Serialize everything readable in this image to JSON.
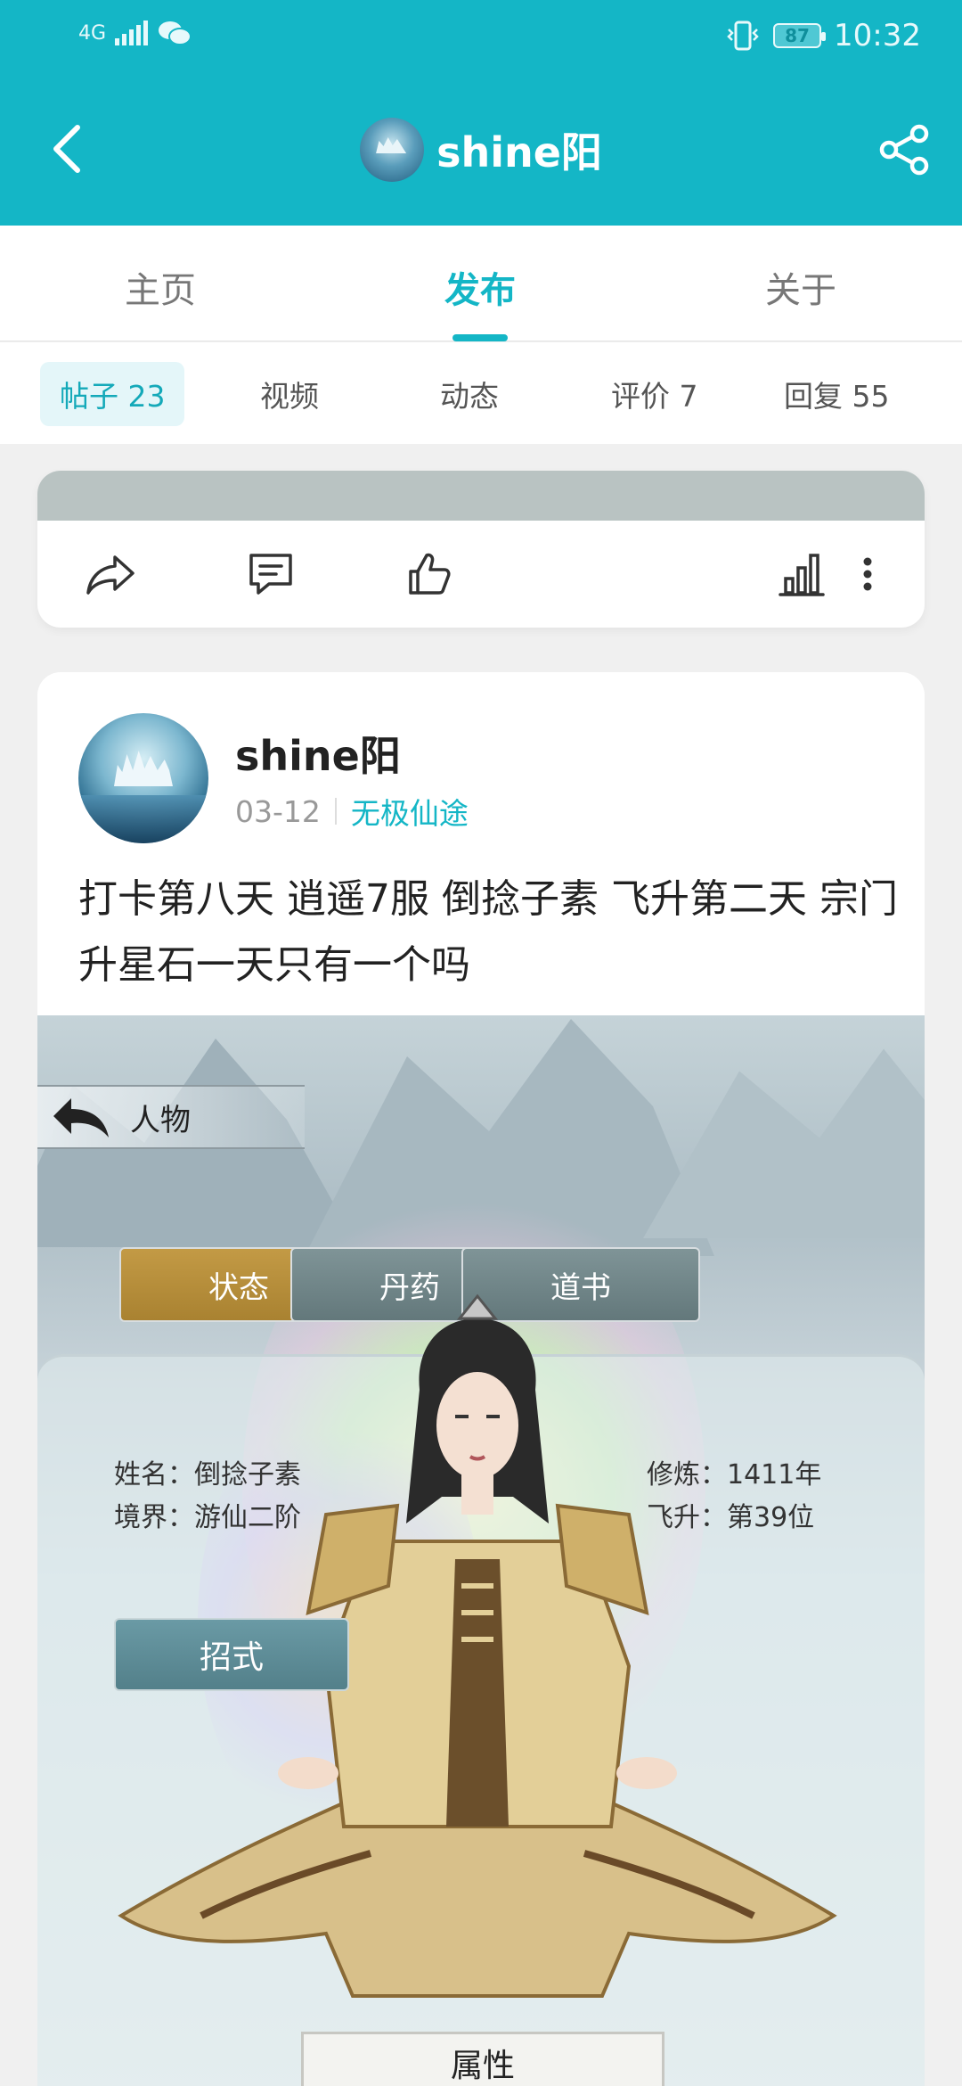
{
  "status_bar": {
    "network": "4G",
    "battery": "87",
    "time": "10:32"
  },
  "navbar": {
    "title": "shine阳",
    "icons": {
      "back": "back-arrow-icon",
      "share": "share-icon"
    }
  },
  "main_tabs": [
    {
      "label": "主页"
    },
    {
      "label": "发布"
    },
    {
      "label": "关于"
    }
  ],
  "sub_tabs": [
    {
      "label": "帖子 23"
    },
    {
      "label": "视频"
    },
    {
      "label": "动态"
    },
    {
      "label": "评价 7"
    },
    {
      "label": "回复 55"
    }
  ],
  "post": {
    "author": "shine阳",
    "date": "03-12",
    "game": "无极仙途",
    "text": "打卡第八天 逍遥7服 倒捻子素 飞升第二天 宗门升星石一天只有一个吗"
  },
  "game_screenshot": {
    "back_label": "人物",
    "tabs": [
      "状态",
      "丹药",
      "道书"
    ],
    "name_line": "姓名：倒捻子素",
    "realm_line": "境界：游仙二阶",
    "cultivate_line": "修炼：1411年",
    "ascend_line": "飞升：第39位",
    "skill_button": "招式",
    "attr_button": "属性"
  },
  "colors": {
    "accent": "#14b6c6",
    "gold_tab": "#c39a45",
    "gray_tab": "#6f8487"
  }
}
